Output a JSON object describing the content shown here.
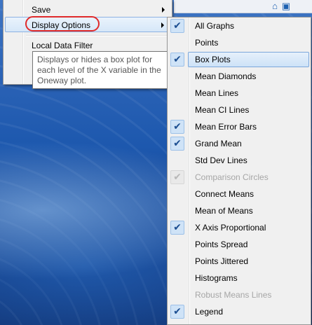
{
  "toolbar": {
    "icons": [
      "home-icon",
      "window-icon"
    ]
  },
  "left_menu": {
    "items": [
      {
        "label": "Save",
        "submenu": true
      },
      {
        "label": "Display Options",
        "submenu": true,
        "highlighted": true
      },
      {
        "label": "Local Data Filter",
        "submenu": false
      }
    ]
  },
  "tooltip": {
    "text": "Displays or hides a box plot for each level of the X variable in the Oneway plot."
  },
  "submenu": {
    "items": [
      {
        "label": "All Graphs",
        "checked": true,
        "disabled": false
      },
      {
        "label": "Points",
        "checked": false,
        "disabled": false
      },
      {
        "label": "Box Plots",
        "checked": true,
        "disabled": false,
        "highlighted": true
      },
      {
        "label": "Mean Diamonds",
        "checked": false,
        "disabled": false
      },
      {
        "label": "Mean Lines",
        "checked": false,
        "disabled": false
      },
      {
        "label": "Mean CI Lines",
        "checked": false,
        "disabled": false
      },
      {
        "label": "Mean Error Bars",
        "checked": true,
        "disabled": false
      },
      {
        "label": "Grand Mean",
        "checked": true,
        "disabled": false
      },
      {
        "label": "Std Dev Lines",
        "checked": false,
        "disabled": false
      },
      {
        "label": "Comparison Circles",
        "checked": true,
        "disabled": true
      },
      {
        "label": "Connect Means",
        "checked": false,
        "disabled": false
      },
      {
        "label": "Mean of Means",
        "checked": false,
        "disabled": false
      },
      {
        "label": "X Axis Proportional",
        "checked": true,
        "disabled": false
      },
      {
        "label": "Points Spread",
        "checked": false,
        "disabled": false
      },
      {
        "label": "Points Jittered",
        "checked": false,
        "disabled": false
      },
      {
        "label": "Histograms",
        "checked": false,
        "disabled": false
      },
      {
        "label": "Robust Means Lines",
        "checked": false,
        "disabled": true
      },
      {
        "label": "Legend",
        "checked": true,
        "disabled": false
      }
    ]
  },
  "colors": {
    "highlight_circle": "#e02a2a",
    "check_fill": "#cfe3f7",
    "background": "#123f86"
  }
}
